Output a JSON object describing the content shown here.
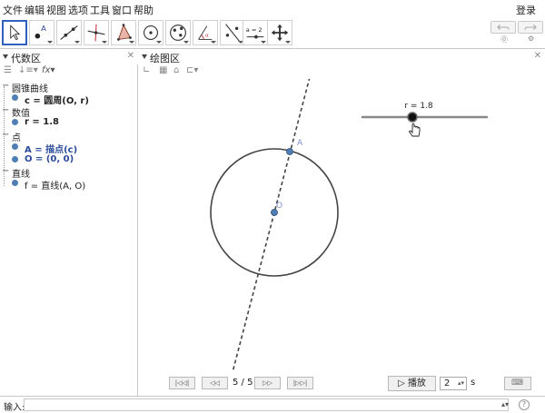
{
  "menu": {
    "items": [
      "文件",
      "编辑",
      "视图",
      "选项",
      "工具",
      "窗口",
      "帮助"
    ],
    "login": "登录"
  },
  "toolbar": {
    "tools": [
      {
        "name": "move-tool",
        "label": ""
      },
      {
        "name": "point-tool",
        "label": "A"
      },
      {
        "name": "line-tool",
        "label": ""
      },
      {
        "name": "perpendicular-tool",
        "label": ""
      },
      {
        "name": "polygon-tool",
        "label": ""
      },
      {
        "name": "circle-tool",
        "label": ""
      },
      {
        "name": "ellipse-tool",
        "label": ""
      },
      {
        "name": "angle-tool",
        "label": ""
      },
      {
        "name": "reflect-tool",
        "label": ""
      },
      {
        "name": "slider-tool",
        "label": "a = 2"
      },
      {
        "name": "move-view-tool",
        "label": ""
      }
    ],
    "active_tool": "move-tool"
  },
  "algebra": {
    "title": "代数区",
    "groups": [
      {
        "label": "圆锥曲线",
        "objects": [
          {
            "text": "c = 圆周(O, r)",
            "bold": true,
            "color": "#222222"
          }
        ]
      },
      {
        "label": "数值",
        "objects": [
          {
            "text": "r = 1.8",
            "bold": true,
            "color": "#222222"
          }
        ]
      },
      {
        "label": "点",
        "objects": [
          {
            "text": "A = 描点(c)",
            "bold": true,
            "color": "#2a4a9a"
          },
          {
            "text": "O = (0, 0)",
            "bold": true,
            "color": "#2a4a9a"
          }
        ]
      },
      {
        "label": "直线",
        "objects": [
          {
            "text": "f = 直线(A, O)",
            "bold": false,
            "color": "#222222"
          }
        ]
      }
    ],
    "bullet_color": "#4f7fb3"
  },
  "graphics": {
    "title": "绘图区",
    "slider": {
      "label": "r = 1.8",
      "value": 1.8
    },
    "points": [
      {
        "label": "A",
        "color": "#7a8fd0"
      },
      {
        "label": "O",
        "color": "#7a8fd0"
      }
    ]
  },
  "playback": {
    "step": "5 / 5",
    "play_label": "播放",
    "speed": "2",
    "speed_unit": "s"
  },
  "input": {
    "label": "输入:",
    "value": "",
    "help": "?"
  }
}
